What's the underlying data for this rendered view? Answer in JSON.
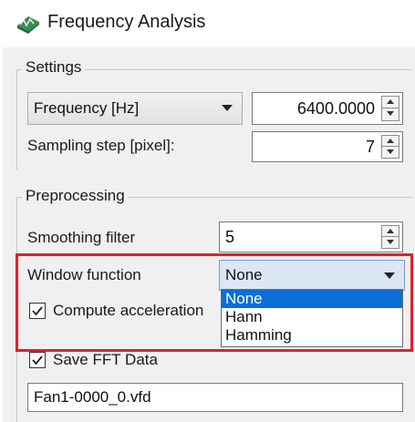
{
  "window": {
    "title": "Frequency Analysis",
    "app_icon": "frequency-analysis-app-icon"
  },
  "settings": {
    "group_title": "Settings",
    "mode_select": "Frequency [Hz]",
    "frequency_value": "6400.0000",
    "sampling_step_label": "Sampling step [pixel]:",
    "sampling_step_value": "7"
  },
  "preprocessing": {
    "group_title": "Preprocessing",
    "smoothing_filter_label": "Smoothing filter",
    "smoothing_filter_value": "5",
    "window_function_label": "Window function",
    "window_function_value": "None",
    "window_function_options": [
      "None",
      "Hann",
      "Hamming"
    ],
    "compute_acceleration_label": "Compute acceleration",
    "compute_acceleration_checked": true
  },
  "save_fft": {
    "label": "Save FFT Data",
    "checked": true,
    "filename": "Fan1-0000_0.vfd"
  },
  "colors": {
    "highlight": "#e0202a",
    "selection": "#0a6fd8",
    "panel_bg": "#f0f0f0"
  }
}
